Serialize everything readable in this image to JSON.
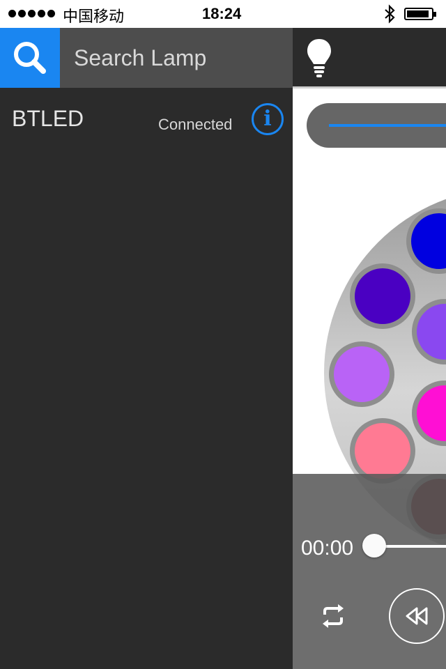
{
  "status_bar": {
    "carrier": "中国移动",
    "time": "18:24",
    "signal_bars": 5,
    "battery_level": 0.85
  },
  "sidebar": {
    "search": {
      "icon": "search-icon",
      "placeholder": "Search Lamp"
    },
    "devices": [
      {
        "name": "BTLED",
        "status": "Connected",
        "icon": "info-icon"
      }
    ]
  },
  "main": {
    "header_icon": "light-bulb-icon",
    "colors": {
      "accent": "#1a86f1",
      "swatches": [
        "#0000e0",
        "#4a00c2",
        "#8a48f0",
        "#b963f6",
        "#ff0fd4",
        "#ff7a93",
        "#5c000f"
      ]
    },
    "player": {
      "time": "00:00",
      "progress": 0,
      "repeat_icon": "repeat-icon",
      "rewind_icon": "rewind-icon"
    }
  }
}
